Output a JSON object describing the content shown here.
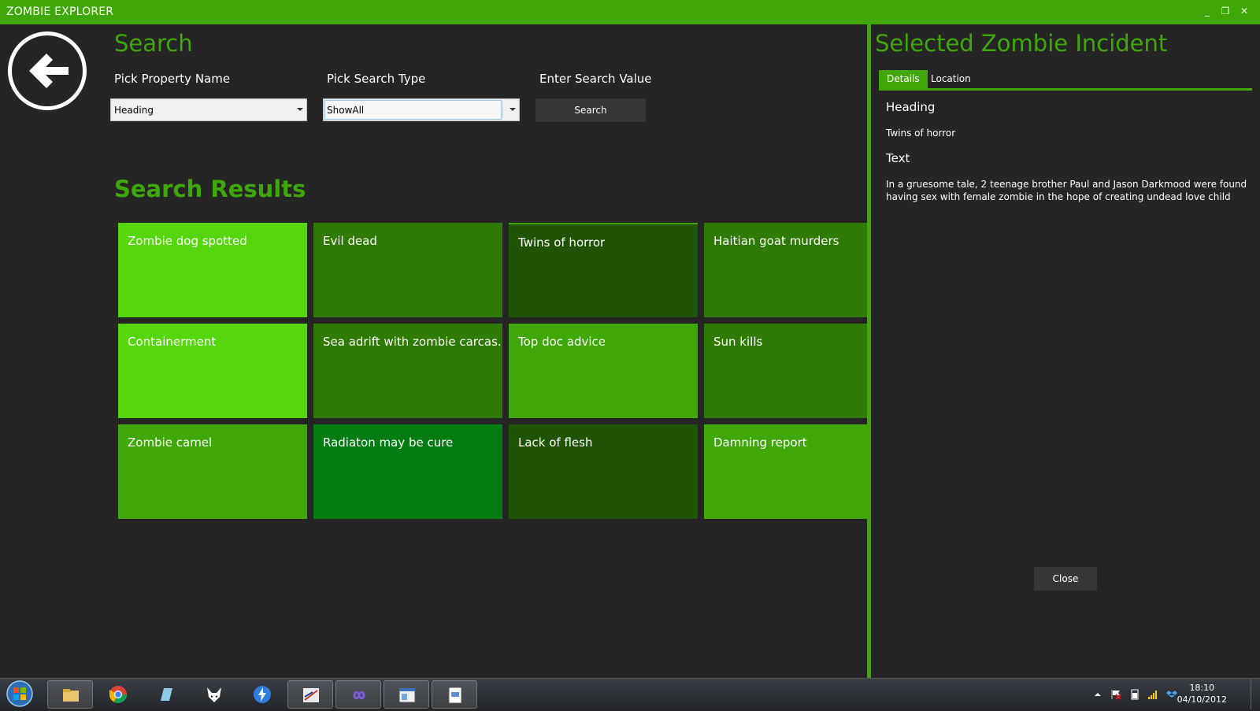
{
  "window": {
    "title": "ZOMBIE EXPLORER",
    "minimize_glyph": "_",
    "restore_glyph": "❐",
    "close_glyph": "✕"
  },
  "search": {
    "heading": "Search",
    "property_label": "Pick Property Name",
    "property_value": "Heading",
    "type_label": "Pick Search Type",
    "type_value": "ShowAll",
    "value_label": "Enter Search Value",
    "button_label": "Search"
  },
  "results": {
    "heading": "Search Results",
    "tiles": [
      {
        "label": "Zombie dog spotted",
        "color": "#56d60c"
      },
      {
        "label": "Evil dead",
        "color": "#2f7a04"
      },
      {
        "label": "Twins of horror",
        "color": "#1f5407"
      },
      {
        "label": "Haitian goat murders",
        "color": "#2f7a04"
      },
      {
        "label": "Containerment",
        "color": "#56d60c"
      },
      {
        "label": "Sea adrift with zombie carcas...",
        "color": "#2f7a04"
      },
      {
        "label": "Top doc advice",
        "color": "#3fa808"
      },
      {
        "label": "Sun kills",
        "color": "#2f7a04"
      },
      {
        "label": "Zombie camel",
        "color": "#3fa808"
      },
      {
        "label": "Radiaton may be cure",
        "color": "#037d12"
      },
      {
        "label": "Lack of flesh",
        "color": "#1f5407"
      },
      {
        "label": "Damning report",
        "color": "#3fa808"
      }
    ]
  },
  "panel": {
    "title": "Selected Zombie Incident",
    "tabs": [
      "Details",
      "Location"
    ],
    "heading_label": "Heading",
    "heading_value": "Twins of horror",
    "text_label": "Text",
    "text_value": "In a gruesome tale, 2 teenage brother Paul and Jason Darkmood were found having sex with female zombie in the hope of creating undead love child",
    "close_label": "Close"
  },
  "taskbar": {
    "apps": [
      "explorer-icon",
      "chrome-icon",
      "notepad-icon",
      "fox-icon",
      "lightning-icon",
      "paint-icon",
      "infinity-icon",
      "window-icon",
      "document-icon"
    ],
    "time": "18:10",
    "date": "04/10/2012"
  },
  "colors": {
    "accent": "#3fa808",
    "background": "#252525"
  }
}
